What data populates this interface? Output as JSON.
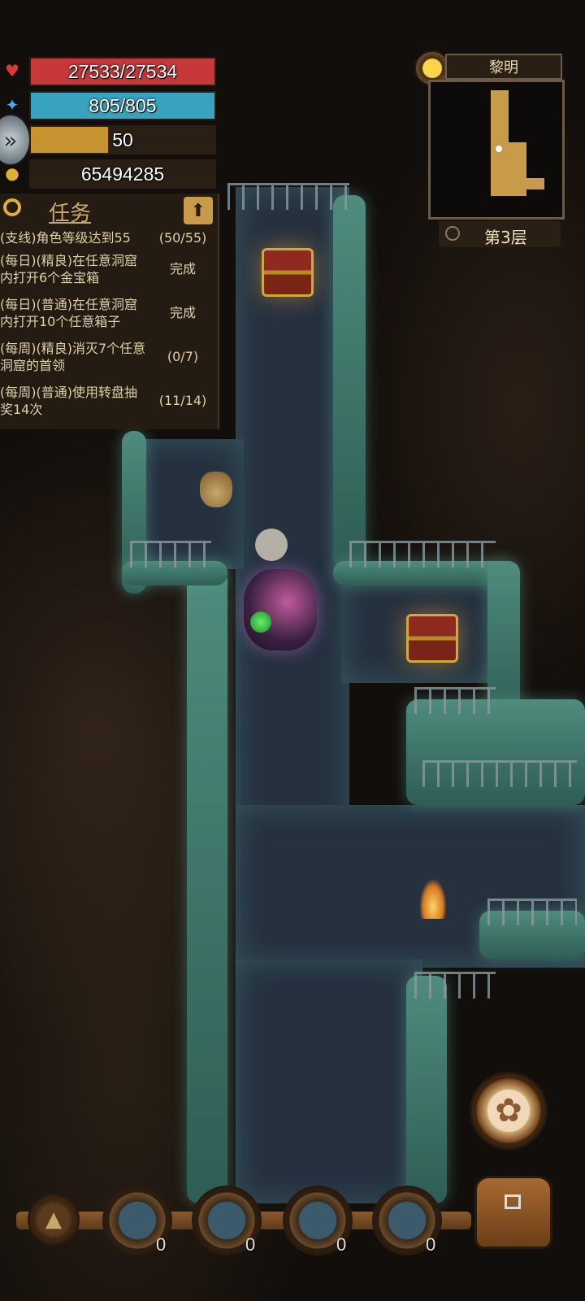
{
  "hud": {
    "hp": {
      "text": "27533/27534",
      "fill": 0.99996,
      "color": "#c8383a"
    },
    "mp": {
      "text": "805/805",
      "fill": 1.0,
      "color": "#37a3bf"
    },
    "exp": {
      "text": "50",
      "fill": 0.42,
      "color": "#c7932e"
    },
    "gold": {
      "text": "65494285"
    }
  },
  "icons": {
    "hp": "heart-icon",
    "mp": "mana-wand-icon",
    "exp": "level-badge-icon",
    "gold": "gold-coins-icon",
    "search": "magnifier-icon",
    "collapse": "arrow-up-icon",
    "time": "sun-icon",
    "zoom": "zoom-icon",
    "paw": "paw-icon",
    "bag": "backpack-icon"
  },
  "quests": {
    "title": "任务",
    "items": [
      {
        "lines": [
          "(支线)角色等级达到55"
        ],
        "status": "(50/55)"
      },
      {
        "lines": [
          "(每日)(精良)在任意洞窟",
          "内打开6个金宝箱"
        ],
        "status": "完成"
      },
      {
        "lines": [
          "(每日)(普通)在任意洞窟",
          "内打开10个任意箱子"
        ],
        "status": "完成"
      },
      {
        "lines": [
          "(每周)(精良)消灭7个任意",
          "洞窟的首领"
        ],
        "status": "(0/7)"
      },
      {
        "lines": [
          "(每周)(普通)使用转盘抽",
          "奖14次"
        ],
        "status": "(11/14)"
      }
    ]
  },
  "minimap": {
    "time_label": "黎明",
    "floor_label": "第3层"
  },
  "quickbar": {
    "items": [
      {
        "name": "scroll-item-1",
        "count": "0"
      },
      {
        "name": "scroll-item-2",
        "count": "0"
      },
      {
        "name": "scroll-item-3",
        "count": "0"
      },
      {
        "name": "scroll-item-4",
        "count": "0"
      }
    ]
  }
}
